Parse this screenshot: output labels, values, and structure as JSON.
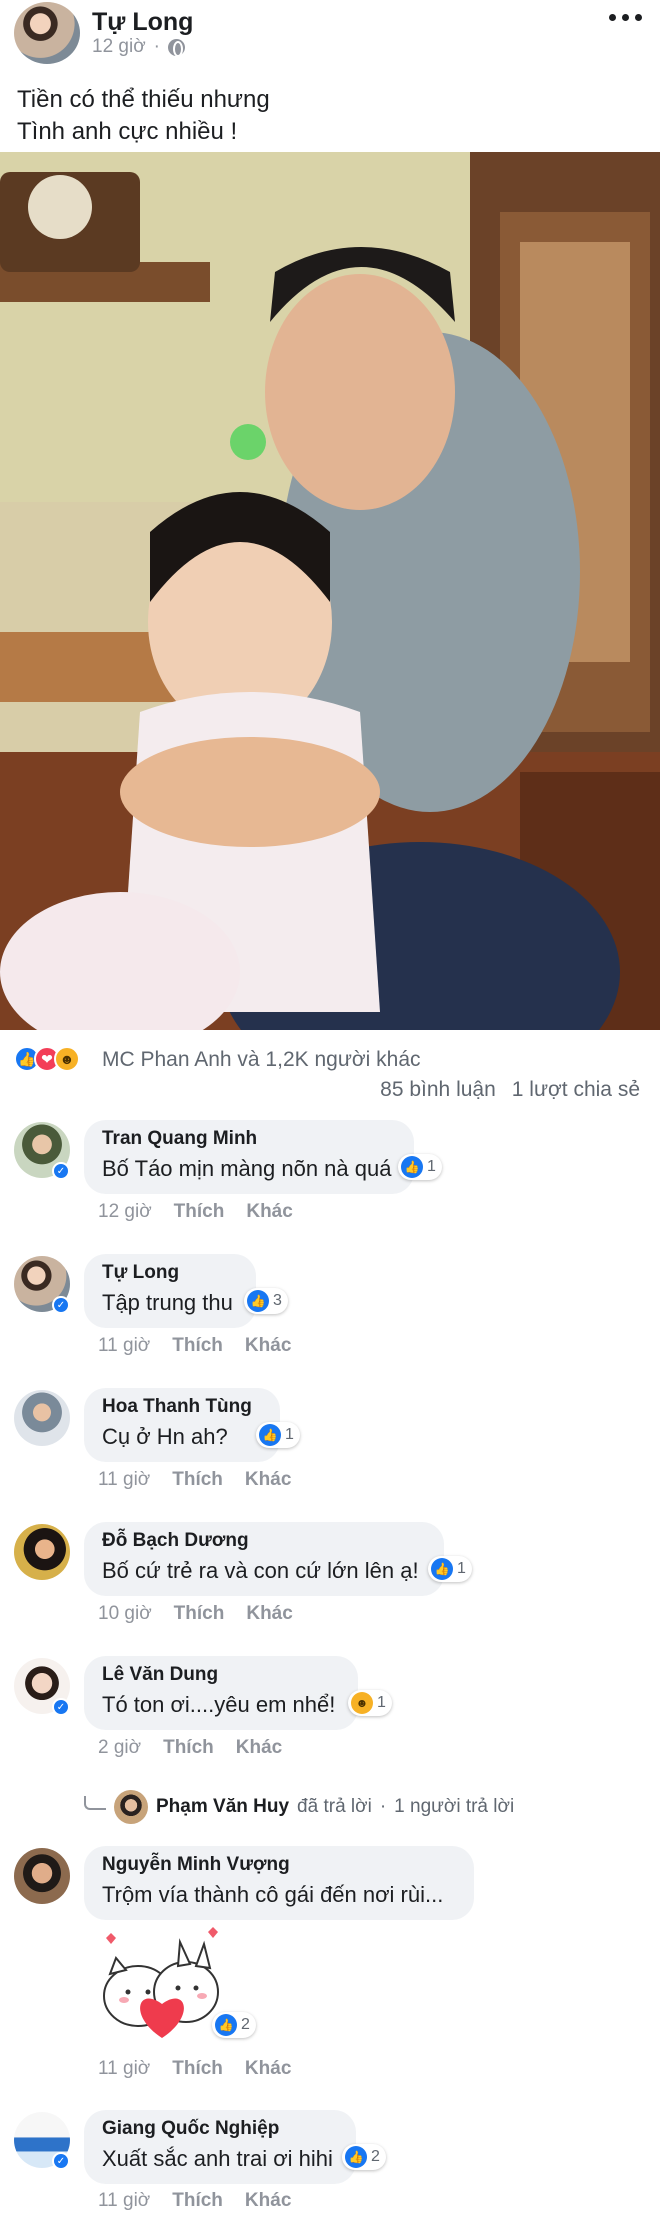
{
  "post": {
    "author": "Tự Long",
    "time": "12 giờ",
    "text_line1": "Tiền có thể thiếu nhưng",
    "text_line2": "Tình anh cực nhiều !",
    "reactions_text": "MC Phan Anh và 1,2K người khác",
    "comments_count": "85 bình luận",
    "shares_count": "1 lượt chia sẻ"
  },
  "comments": [
    {
      "name": "Tran Quang Minh",
      "text": "Bố Táo mịn màng nõn nà quá",
      "reactions": "1",
      "time": "12 giờ",
      "like": "Thích",
      "more": "Khác"
    },
    {
      "name": "Tự Long",
      "text": "Tập trung thu",
      "reactions": "3",
      "time": "11 giờ",
      "like": "Thích",
      "more": "Khác"
    },
    {
      "name": "Hoa Thanh Tùng",
      "text": "Cụ ở Hn ah?",
      "reactions": "1",
      "time": "11 giờ",
      "like": "Thích",
      "more": "Khác"
    },
    {
      "name": "Đỗ Bạch Dương",
      "text": "Bố cứ trẻ ra và con cứ lớn lên ạ!",
      "reactions": "1",
      "time": "10 giờ",
      "like": "Thích",
      "more": "Khác"
    },
    {
      "name": "Lê Văn Dung",
      "text": "Tó ton ơi....yêu em nhể!",
      "reactions": "1",
      "time": "2 giờ",
      "like": "Thích",
      "more": "Khác"
    },
    {
      "name": "Nguyễn Minh Vượng",
      "text": "Trộm vía thành cô gái đến nơi rùi...",
      "reactions": "2",
      "time": "11 giờ",
      "like": "Thích",
      "more": "Khác"
    },
    {
      "name": "Giang Quốc Nghiệp",
      "text": "Xuất sắc anh trai ơi hihi",
      "reactions": "2",
      "time": "11 giờ",
      "like": "Thích",
      "more": "Khác"
    }
  ],
  "reply": {
    "name": "Phạm Văn Huy",
    "action": "đã trả lời",
    "separator": "·",
    "count": "1 người trả lời"
  },
  "icons": {
    "like": "thumbs-up-icon",
    "love": "heart-icon",
    "haha": "laughing-face-icon",
    "privacy": "globe-icon",
    "options": "more-icon"
  },
  "colors": {
    "accent": "#1877f2",
    "love": "#f33e58",
    "haha": "#f7b125",
    "bubble": "#f0f2f5",
    "meta": "#90949c"
  }
}
